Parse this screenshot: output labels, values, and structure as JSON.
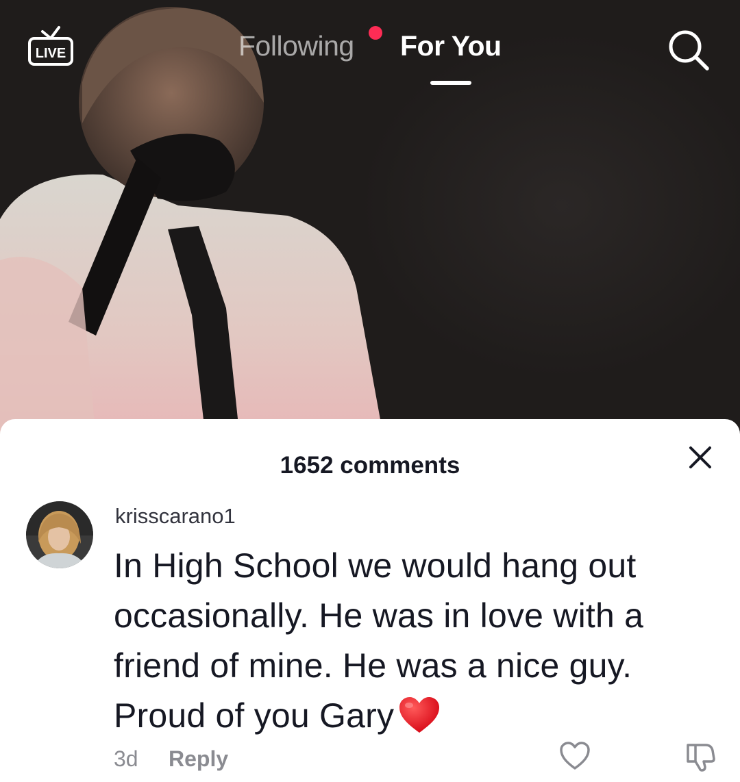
{
  "topbar": {
    "live_label": "LIVE",
    "tabs": [
      {
        "label": "Following",
        "active": false,
        "has_notification": true
      },
      {
        "label": "For You",
        "active": true
      }
    ],
    "icons": {
      "live": "live-tv-icon",
      "search": "search-icon"
    }
  },
  "comments_sheet": {
    "title": "1652 comments",
    "close_icon": "close-icon",
    "comments": [
      {
        "username": "krisscarano1",
        "avatar": "avatar",
        "text": "In High School we would hang out occasionally. He was in love with a friend of mine. He was a nice guy. Proud of you Gary",
        "emoji": "red-heart",
        "time": "3d",
        "reply_label": "Reply",
        "like_icon": "heart-outline-icon",
        "dislike_icon": "thumbs-down-icon"
      }
    ]
  },
  "colors": {
    "accent": "#fe2c55",
    "sheet_background": "#ffffff",
    "primary_text": "#161823",
    "secondary_text": "#8a8b91"
  }
}
